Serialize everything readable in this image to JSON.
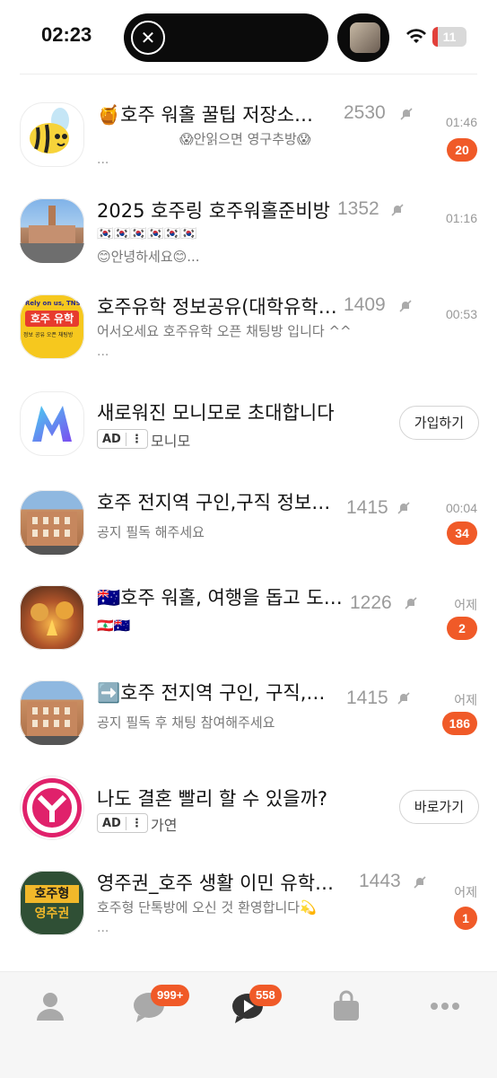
{
  "status_bar": {
    "time": "02:23",
    "battery": "11"
  },
  "chats": [
    {
      "title": "🍯호주 워홀 꿀팁 저장소…",
      "members": "2530",
      "sub": "😱안읽으면 영구추방😱",
      "preview_more": "...",
      "time": "01:46",
      "unread": "20"
    },
    {
      "title": "2025 호주링 호주워홀준비방",
      "members": "1352",
      "sub": "🇰🇷🇰🇷🇰🇷🇰🇷🇰🇷🇰🇷",
      "sub2": "😊안녕하세요😊...",
      "time": "01:16"
    },
    {
      "title": "호주유학 정보공유(대학유학…",
      "members": "1409",
      "sub": "어서오세요 호주유학 오픈 채팅방 입니다 ^^",
      "preview_more": "...",
      "time": "00:53"
    },
    {
      "title": "호주 전지역 구인,구직 정보…",
      "members": "1415",
      "sub": "공지 필독 해주세요",
      "time": "00:04",
      "unread": "34"
    },
    {
      "title": "🇦🇺호주 워홀, 여행을 돕고 도…",
      "members": "1226",
      "sub": "🇱🇧🇦🇺",
      "time": "어제",
      "unread": "2"
    },
    {
      "title": "➡️호주 전지역 구인, 구직,…",
      "members": "1415",
      "sub": "공지 필독 후 채팅 참여해주세요",
      "time": "어제",
      "unread": "186"
    },
    {
      "title": "영주권_호주 생활 이민 유학…",
      "members": "1443",
      "sub": "호주형 단톡방에 오신 것 환영합니다💫",
      "preview_more": "...",
      "time": "어제",
      "unread": "1"
    }
  ],
  "ads": [
    {
      "title": "새로워진 모니모로 초대합니다",
      "ad_label": "AD",
      "menu": "⋮",
      "advertiser": "모니모",
      "cta": "가입하기"
    },
    {
      "title": "나도 결혼 빨리 할 수 있을까?",
      "ad_label": "AD",
      "menu": "⋮",
      "advertiser": "가연",
      "cta": "바로가기"
    }
  ],
  "avatar_texts": {
    "study": "호주 유학",
    "study_small": "정보 공유 오픈 채팅방",
    "study_top": "Rely on us, TNS!",
    "residency_top": "호주형",
    "residency_bottom": "영주권"
  },
  "tabbar": {
    "chats_badge": "999+",
    "openchat_badge": "558"
  },
  "colors": {
    "accent": "#f05a28",
    "muted": "#999999"
  }
}
